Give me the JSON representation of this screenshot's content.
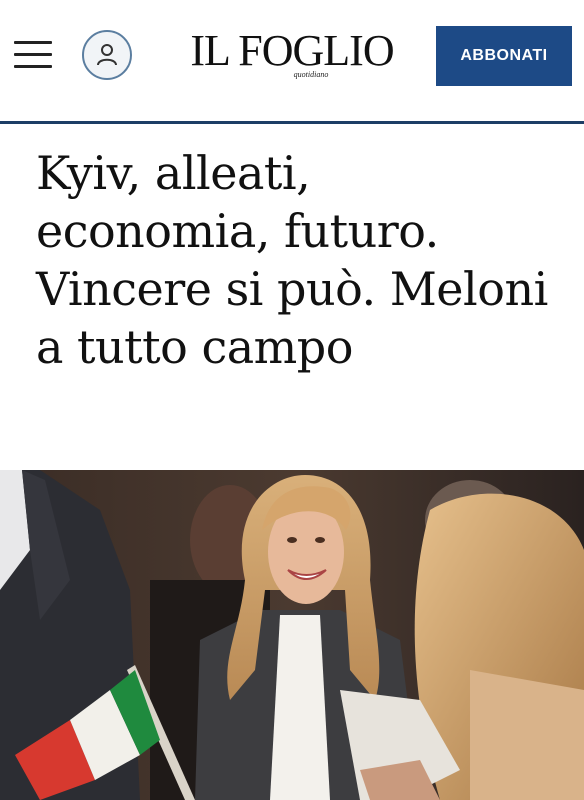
{
  "header": {
    "menu_icon": "hamburger-menu-icon",
    "account_icon": "user-icon",
    "logo_title": "IL FOGLIO",
    "logo_subtitle": "quotidiano",
    "subscribe_label": "ABBONATI",
    "accent_color": "#1d4a86"
  },
  "article": {
    "headline": "Kyiv, alleati, economia, futuro. Vincere si può. Meloni a tutto campo"
  },
  "photo": {
    "subject": "hero-photo"
  }
}
